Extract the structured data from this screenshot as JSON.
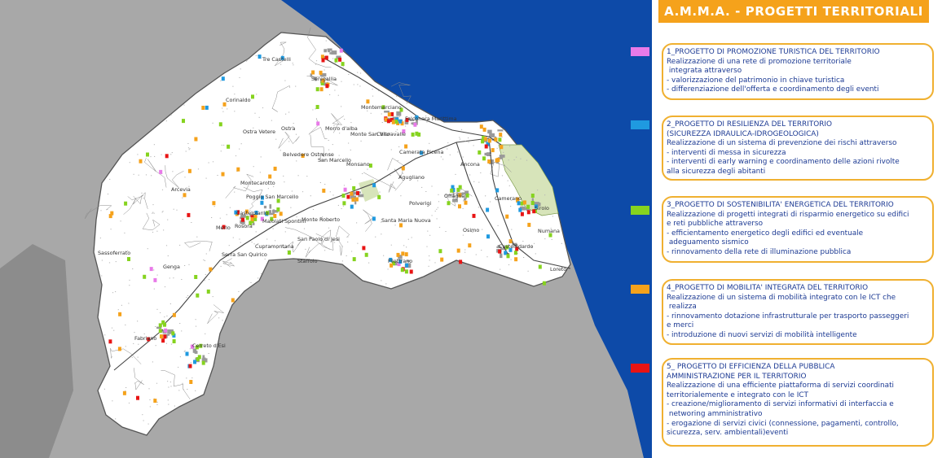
{
  "title": "A.M.M.A. - PROGETTI TERRITORIALI",
  "colors": {
    "sea": "#0d4aa8",
    "outside_land": "#a8a8a8",
    "territory": "#ffffff",
    "panel_bg": "#ffffff",
    "title_bg": "#f5a21b",
    "box_border": "#f0b030",
    "text": "#1c3a93",
    "protected_area": "#d7e4ba"
  },
  "projects": [
    {
      "color": "#e87ae8",
      "heading": "1_PROGETTO DI PROMOZIONE TURISTICA DEL TERRITORIO",
      "lines": [
        "Realizzazione di una rete di promozione territoriale",
        " integrata attraverso",
        "- valorizzazione del patrimonio in chiave turistica",
        "- differenziazione dell'offerta e coordinamento degli eventi"
      ]
    },
    {
      "color": "#1f9ae0",
      "heading": "2_PROGETTO DI RESILIENZA DEL TERRITORIO (SICUREZZA IDRAULICA-IDROGEOLOGICA)",
      "lines": [
        "Realizzazione di un sistema di prevenzione dei rischi attraverso",
        "- interventi di messa in sicurezza",
        "- interventi di early warning e coordinamento delle azioni rivolte",
        "alla sicurezza degli abitanti"
      ]
    },
    {
      "color": "#86d31f",
      "heading": "3_PROGETTO DI SOSTENIBILITA' ENERGETICA DEL TERRITORIO",
      "lines": [
        "Realizzazione di progetti integrati di risparmio energetico su edifici",
        "e reti pubbliche attraverso",
        "- efficientamento energetico degli edifici ed eventuale",
        " adeguamento sismico",
        "- rinnovamento della rete di illuminazione pubblica"
      ]
    },
    {
      "color": "#f5a21b",
      "heading": "4_PROGETTO DI MOBILITA' INTEGRATA DEL TERRITORIO",
      "lines": [
        "Realizzazione di un sistema di mobilità integrato con le ICT che",
        " realizza",
        "- rinnovamento dotazione infrastrutturale per trasporto passeggeri",
        "e merci",
        "- introduzione di nuovi servizi di mobilità intelligente"
      ]
    },
    {
      "color": "#e81414",
      "heading": "5_ PROGETTO DI EFFICIENZA DELLA PUBBLICA AMMINISTRAZIONE PER IL TERRITORIO",
      "lines": [
        "Realizzazione di una efficiente piattaforma di servizi coordinati",
        "territorialemente e integrato con le ICT",
        "- creazione/miglioramento di servizi informativi di interfaccia e",
        " networing amministrativo",
        "- erogazione di servizi civici (connessione, pagamenti, controllo,",
        "sicurezza, serv. ambientali)eventi"
      ]
    }
  ],
  "towns": [
    "Tre Castelli",
    "Senigallia",
    "Corinaldo",
    "Montemarciano",
    "Falconara Marittima",
    "Ostra Vetere",
    "Ostra",
    "Morro d'alba",
    "Monte San Vito",
    "Chiaravalle",
    "Belvedere Ostrense",
    "San Marcello",
    "Monsano",
    "Camerata Picena",
    "Ancona",
    "Montecarotto",
    "Agugliano",
    "Arcevia",
    "Poggio San Marcello",
    "Offagna",
    "Polverigi",
    "Camerano",
    "Sirolo",
    "Castelplanio",
    "Maiolati Spontini",
    "Monte Roberto",
    "Merlo",
    "Rosora",
    "Santa Maria Nuova",
    "Numana",
    "Sassoferrato",
    "Cupramontana",
    "San Paolo di Jesi",
    "Osimo",
    "Castelfidardo",
    "Genga",
    "Serra San Quirico",
    "Staffolo",
    "Filottrano",
    "Loreto",
    "Fabriano",
    "Cerreto d'Esi"
  ]
}
